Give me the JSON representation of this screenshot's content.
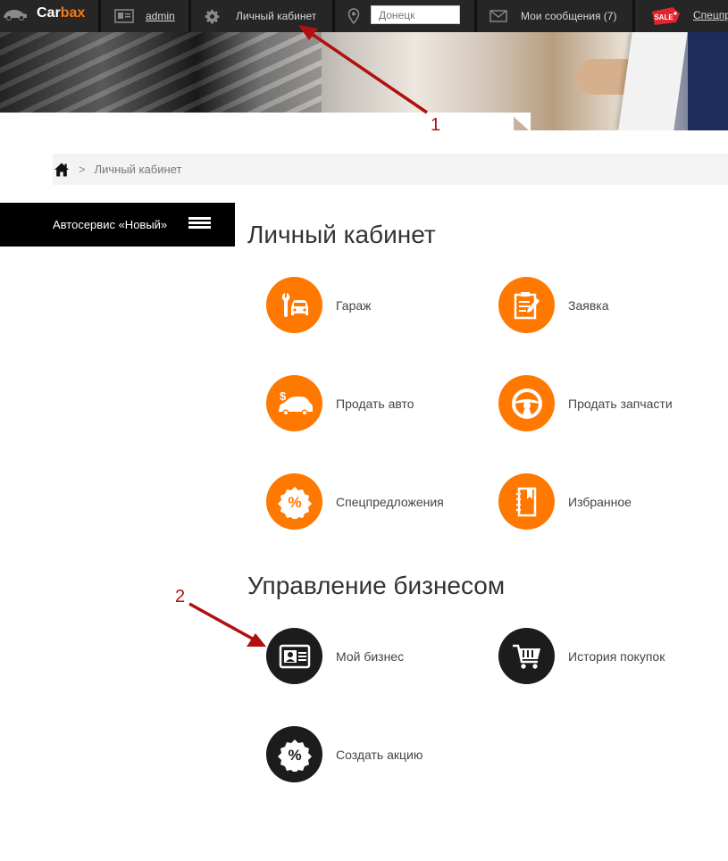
{
  "header": {
    "logo": {
      "part1": "Car",
      "part2": "bax"
    },
    "user": {
      "name": "admin"
    },
    "cabinet_label": "Личный кабинет",
    "city": {
      "placeholder": "Донецк"
    },
    "messages_label": "Мои сообщения (7)",
    "sale_badge": "SALE",
    "special_label": "Спецпр"
  },
  "breadcrumb": {
    "separator": ">",
    "current": "Личный кабинет"
  },
  "sidebar": {
    "title": "Автосервис «Новый»"
  },
  "cabinet": {
    "title": "Личный кабинет",
    "items": [
      {
        "label": "Гараж",
        "icon": "garage-wrench-car-icon"
      },
      {
        "label": "Заявка",
        "icon": "request-document-icon"
      },
      {
        "label": "Продать авто",
        "icon": "sell-car-dollar-icon"
      },
      {
        "label": "Продать запчасти",
        "icon": "steering-wheel-icon"
      },
      {
        "label": "Спецпредложения",
        "icon": "percent-badge-icon"
      },
      {
        "label": "Избранное",
        "icon": "bookmark-notebook-icon"
      }
    ]
  },
  "business": {
    "title": "Управление бизнесом",
    "items": [
      {
        "label": "Мой бизнес",
        "icon": "id-card-icon"
      },
      {
        "label": "История покупок",
        "icon": "shopping-cart-icon"
      },
      {
        "label": "Создать акцию",
        "icon": "percent-badge-icon"
      }
    ]
  },
  "annotations": {
    "arrow1_number": "1",
    "arrow2_number": "2"
  },
  "colors": {
    "accent": "#ff7800",
    "dark_circle": "#1c1c1c",
    "topbar": "#262626",
    "annotation": "#b01010"
  }
}
